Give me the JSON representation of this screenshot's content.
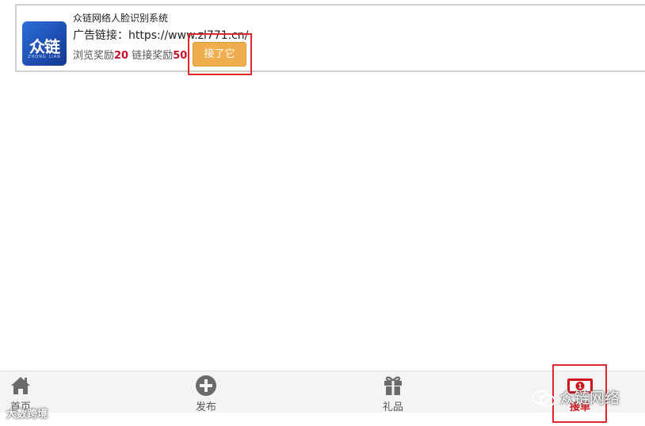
{
  "ad": {
    "title": "众链网络人脸识别系统",
    "logo_text": "众链",
    "logo_sub": "ZHONG LIAN",
    "link_label": "广告链接：",
    "link_url": "https://www.zl771.cn/",
    "browse_reward_label": "浏览奖励",
    "browse_reward_value": "20",
    "link_reward_label": "链接奖励",
    "link_reward_value": "50",
    "accept_button": "接了它"
  },
  "tabbar": {
    "home": "首页",
    "publish": "发布",
    "gift": "礼品",
    "order": "接单",
    "order_badge": "1"
  },
  "watermark": {
    "left": "大数跨境",
    "right": "众链网络"
  },
  "colors": {
    "accent_button": "#f0ad4e",
    "reward_number": "#c8102e",
    "active_tab": "#d0121b",
    "highlight": "#e0262e"
  }
}
